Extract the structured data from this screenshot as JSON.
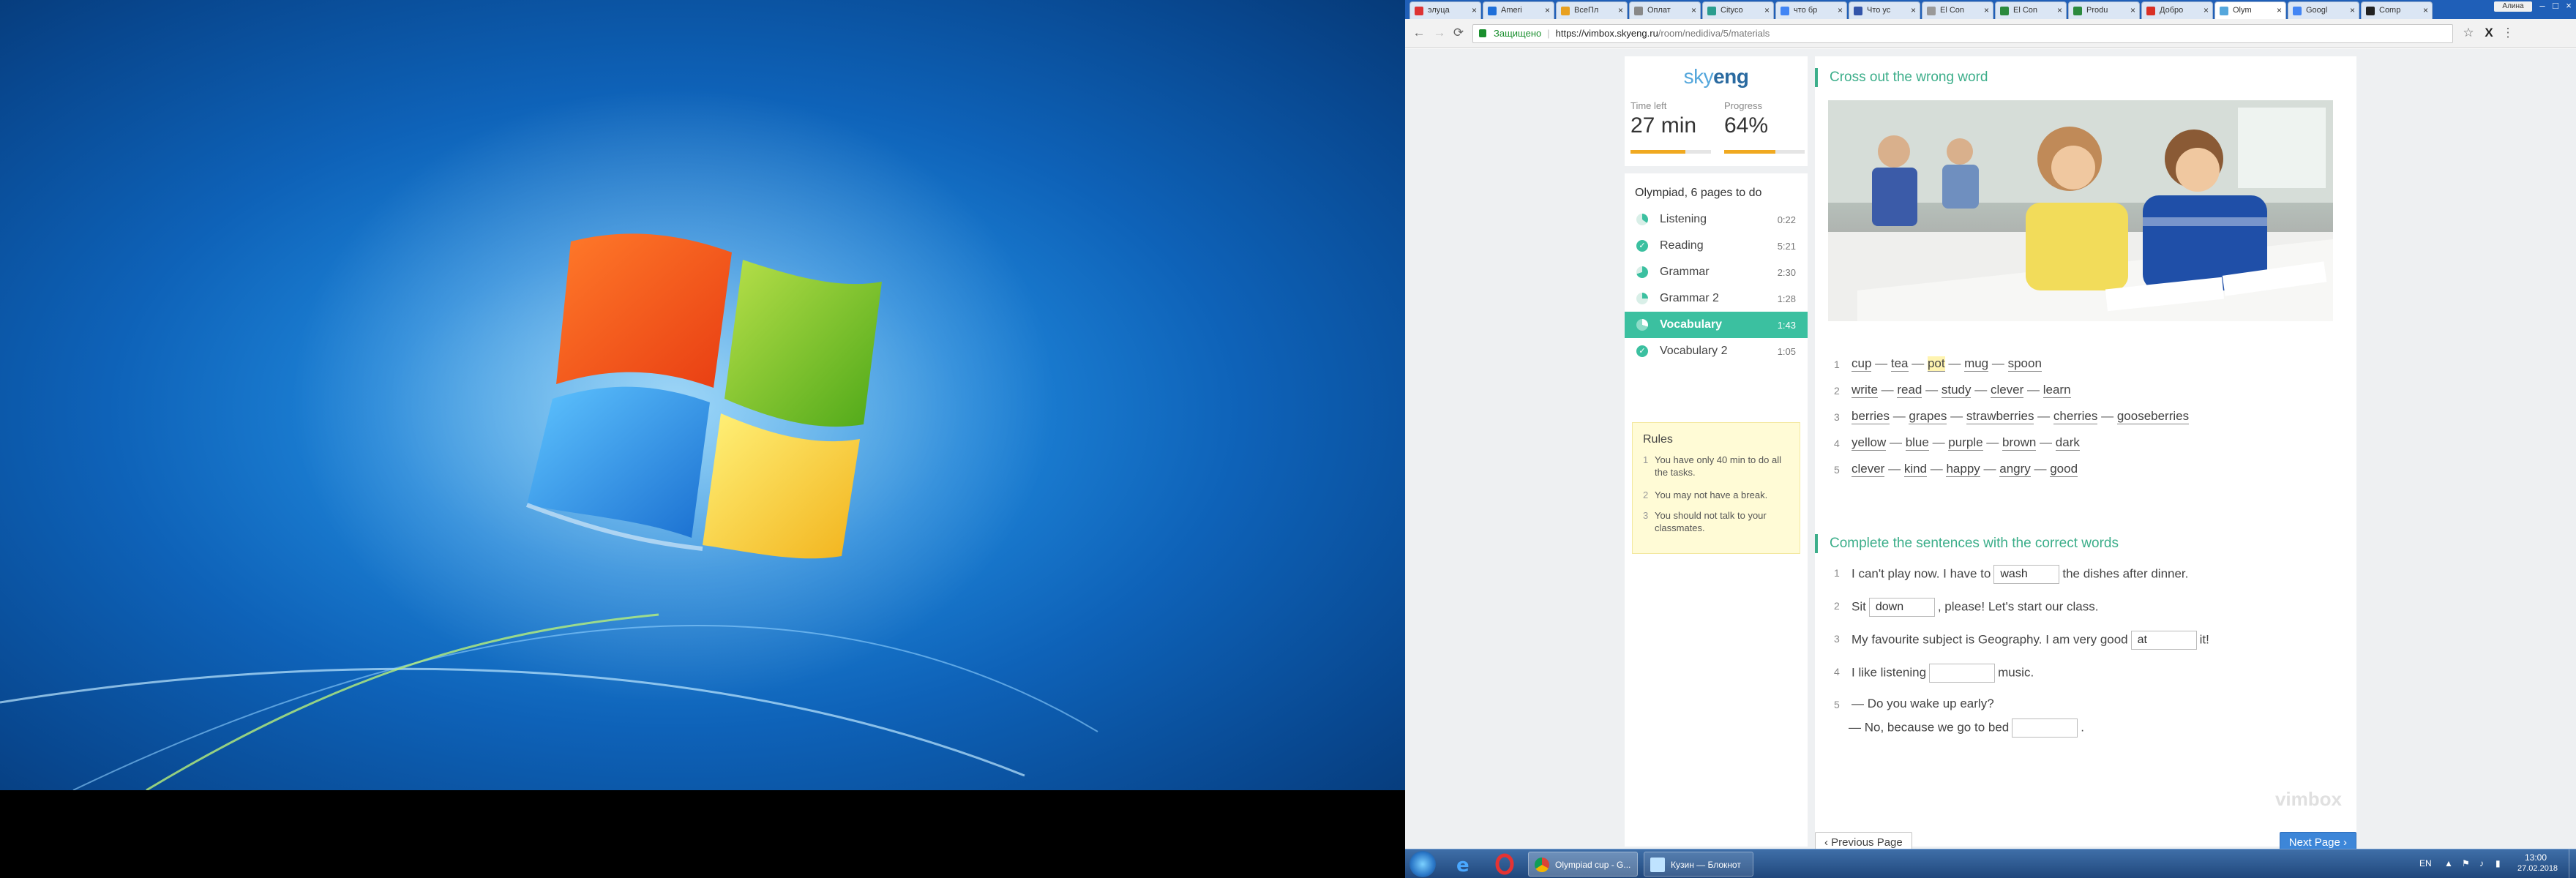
{
  "browser": {
    "tabs": [
      {
        "label": "элуца"
      },
      {
        "label": "Ameri"
      },
      {
        "label": "ВсеПл"
      },
      {
        "label": "Оплат"
      },
      {
        "label": "Cityco"
      },
      {
        "label": "что бр"
      },
      {
        "label": "Что ус"
      },
      {
        "label": "El Con"
      },
      {
        "label": "El Con"
      },
      {
        "label": "Produ"
      },
      {
        "label": "Добро"
      },
      {
        "label": "Olym"
      },
      {
        "label": "Googl"
      },
      {
        "label": "Comp"
      }
    ],
    "user_label": "Алина",
    "secure_label": "Защищено",
    "url_host": "https://vimbox.skyeng.ru",
    "url_path": "/room/nedidiva/5/materials"
  },
  "sidebar": {
    "logo_sky": "sky",
    "logo_eng": "eng",
    "time_label": "Time left",
    "time_value": "27 min",
    "time_fraction": 0.68,
    "progress_label": "Progress",
    "progress_value": "64%",
    "progress_fraction": 0.64,
    "pages_title": "Olympiad, 6 pages to do",
    "items": [
      {
        "label": "Listening",
        "time": "0:22",
        "status": "partial"
      },
      {
        "label": "Reading",
        "time": "5:21",
        "status": "done"
      },
      {
        "label": "Grammar",
        "time": "2:30",
        "status": "partial"
      },
      {
        "label": "Grammar 2",
        "time": "1:28",
        "status": "partial"
      },
      {
        "label": "Vocabulary",
        "time": "1:43",
        "status": "active"
      },
      {
        "label": "Vocabulary 2",
        "time": "1:05",
        "status": "done"
      }
    ],
    "rules_title": "Rules",
    "rules": [
      {
        "n": "1",
        "text": "You have only 40 min to do all the tasks."
      },
      {
        "n": "2",
        "text": "You may not have a break."
      },
      {
        "n": "3",
        "text": "You should not talk to your classmates."
      }
    ]
  },
  "exercise1": {
    "title": "Cross out the wrong word",
    "rows": [
      {
        "n": "1",
        "words": [
          "cup",
          "tea",
          "pot",
          "mug",
          "spoon"
        ],
        "highlight": 2
      },
      {
        "n": "2",
        "words": [
          "write",
          "read",
          "study",
          "clever",
          "learn"
        ],
        "highlight": -1
      },
      {
        "n": "3",
        "words": [
          "berries",
          "grapes",
          "strawberries",
          "cherries",
          "gooseberries"
        ],
        "highlight": -1
      },
      {
        "n": "4",
        "words": [
          "yellow",
          "blue",
          "purple",
          "brown",
          "dark"
        ],
        "highlight": -1
      },
      {
        "n": "5",
        "words": [
          "clever",
          "kind",
          "happy",
          "angry",
          "good"
        ],
        "highlight": -1
      }
    ]
  },
  "exercise2": {
    "title": "Complete the sentences with the correct words",
    "rows": [
      {
        "n": "1",
        "before": "I can't play now. I have to",
        "value": "wash",
        "after": "the dishes after dinner."
      },
      {
        "n": "2",
        "before": "Sit",
        "value": "down",
        "after": ", please! Let's start our class."
      },
      {
        "n": "3",
        "before": "My favourite subject is Geography. I am very good",
        "value": "at",
        "after": "it!"
      },
      {
        "n": "4",
        "before": "I like listening",
        "value": "",
        "after": "music."
      },
      {
        "n": "5",
        "line1": "— Do you wake up early?",
        "before": "— No, because we go to bed",
        "value": "",
        "after": "."
      }
    ]
  },
  "footer": {
    "brand": "vimbox",
    "prev_label": "Previous Page",
    "next_label": "Next Page"
  },
  "taskbar": {
    "apps": [
      {
        "label": "Olympiad cup - G..."
      },
      {
        "label": "Кузин — Блокнот"
      }
    ],
    "lang": "EN",
    "time": "13:00",
    "date": "27.02.2018"
  },
  "colors": {
    "accent_green": "#3cae8a",
    "active_item": "#3bc0a0",
    "progress_orange": "#f0a920",
    "next_blue": "#3d86d8"
  }
}
